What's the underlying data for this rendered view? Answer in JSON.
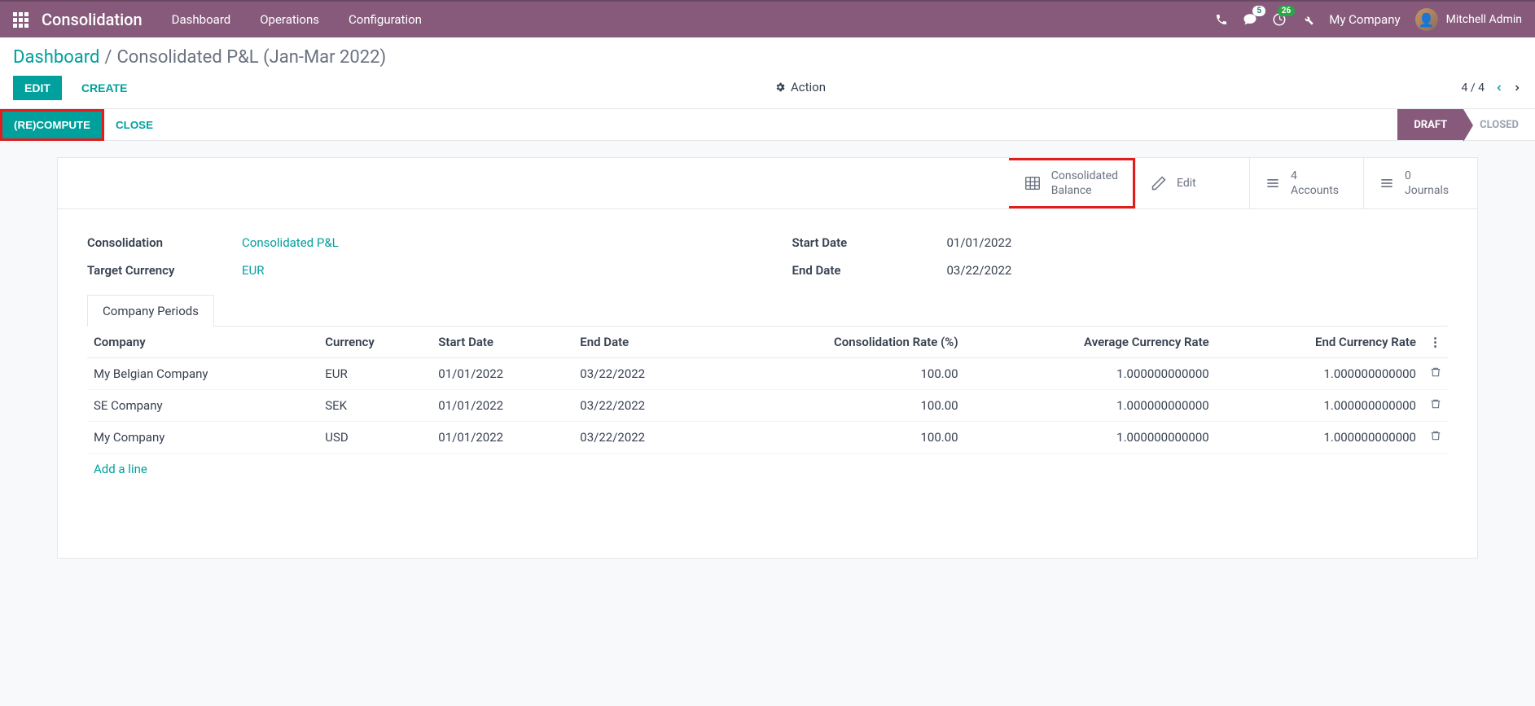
{
  "nav": {
    "brand": "Consolidation",
    "menu": [
      "Dashboard",
      "Operations",
      "Configuration"
    ],
    "msg_badge": "5",
    "act_badge": "26",
    "company": "My Company",
    "user": "Mitchell Admin"
  },
  "breadcrumb": {
    "root": "Dashboard",
    "current": "Consolidated P&L (Jan-Mar 2022)"
  },
  "ctrl": {
    "edit": "EDIT",
    "create": "CREATE",
    "action": "Action",
    "pager": "4 / 4"
  },
  "status": {
    "recompute": "(RE)COMPUTE",
    "close": "CLOSE",
    "draft": "DRAFT",
    "closed": "CLOSED"
  },
  "stats": {
    "balance1": "Consolidated",
    "balance2": "Balance",
    "edit": "Edit",
    "accounts_n": "4",
    "accounts": "Accounts",
    "journals_n": "0",
    "journals": "Journals"
  },
  "form": {
    "consolidation_label": "Consolidation",
    "consolidation_value": "Consolidated P&L",
    "currency_label": "Target Currency",
    "currency_value": "EUR",
    "start_label": "Start Date",
    "start_value": "01/01/2022",
    "end_label": "End Date",
    "end_value": "03/22/2022"
  },
  "tab": {
    "label": "Company Periods"
  },
  "table": {
    "headers": {
      "company": "Company",
      "currency": "Currency",
      "start": "Start Date",
      "end": "End Date",
      "rate": "Consolidation Rate (%)",
      "avg": "Average Currency Rate",
      "endc": "End Currency Rate"
    },
    "rows": [
      {
        "company": "My Belgian Company",
        "currency": "EUR",
        "start": "01/01/2022",
        "end": "03/22/2022",
        "rate": "100.00",
        "avg": "1.000000000000",
        "endc": "1.000000000000"
      },
      {
        "company": "SE Company",
        "currency": "SEK",
        "start": "01/01/2022",
        "end": "03/22/2022",
        "rate": "100.00",
        "avg": "1.000000000000",
        "endc": "1.000000000000"
      },
      {
        "company": "My Company",
        "currency": "USD",
        "start": "01/01/2022",
        "end": "03/22/2022",
        "rate": "100.00",
        "avg": "1.000000000000",
        "endc": "1.000000000000"
      }
    ],
    "addline": "Add a line"
  }
}
